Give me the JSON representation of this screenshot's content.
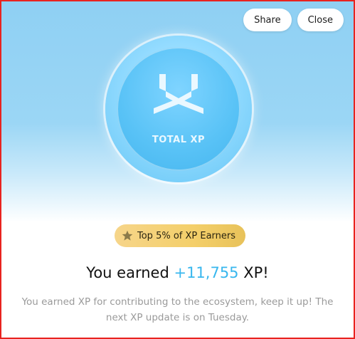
{
  "header": {
    "share_label": "Share",
    "close_label": "Close"
  },
  "coin": {
    "label": "TOTAL XP",
    "icon": "xp-logo-icon"
  },
  "badge": {
    "icon": "star-icon",
    "label": "Top 5% of XP Earners"
  },
  "headline": {
    "prefix": "You earned ",
    "amount": "+11,755",
    "suffix": " XP!"
  },
  "subtext": "You earned XP for contributing to the ecosystem, keep it up! The next XP update is on Tuesday.",
  "colors": {
    "accent": "#38b7ee",
    "badge_gold": "#f4cf6a",
    "border": "#e8231f"
  }
}
